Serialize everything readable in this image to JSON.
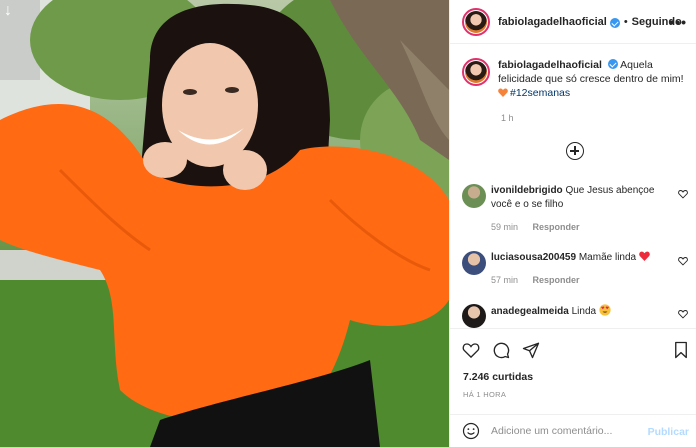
{
  "post": {
    "username": "fabiolagadelhaoficial",
    "follow_label": "Seguindo",
    "more_label": "•••",
    "separator": "•",
    "caption_user": "fabiolagadelhaoficial",
    "caption_text": "Aquela felicidade que só cresce dentro de mim!",
    "caption_hashtag": "#12semanas",
    "caption_time": "1 h",
    "likes": "7.246 curtidas",
    "time_ago": "HÁ 1 HORA"
  },
  "comments": [
    {
      "user": "ivonildebrigido",
      "text": "Que Jesus abençoe você e o se filho",
      "time": "59 min",
      "reply": "Responder"
    },
    {
      "user": "luciasousa200459",
      "text": "Mamãe linda",
      "time": "57 min",
      "reply": "Responder"
    },
    {
      "user": "anadegealmeida",
      "text": "Linda"
    }
  ],
  "comment_box": {
    "placeholder": "Adicione um comentário...",
    "publish_label": "Publicar"
  },
  "icons": {
    "download": "download-arrow-icon",
    "verified": "verified-badge-icon",
    "more": "more-options-icon",
    "add": "plus-circle-icon",
    "like": "heart-icon",
    "comment": "comment-bubble-icon",
    "share": "paper-plane-icon",
    "save": "bookmark-icon",
    "emoji": "emoji-smiley-icon"
  },
  "colors": {
    "verified": "#3897f0",
    "link": "#00376b",
    "publish_disabled": "#b3dbff",
    "heart_red": "#ed4956",
    "heart_orange": "#f5833a",
    "sweater": "#ff6a13"
  }
}
